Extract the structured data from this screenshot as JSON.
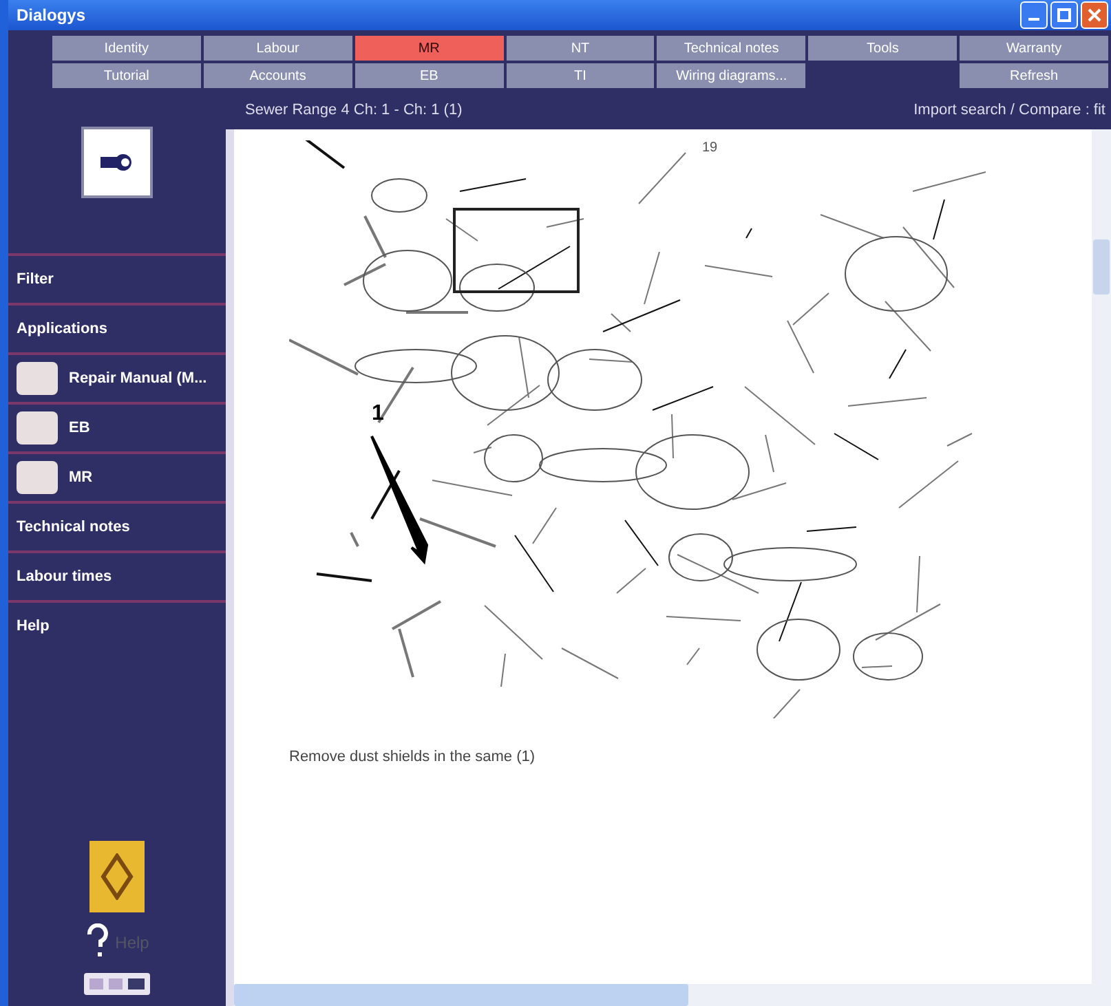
{
  "window": {
    "title": "Dialogys"
  },
  "tabs_row_1": [
    {
      "label": "Identity",
      "selected": false
    },
    {
      "label": "Labour",
      "selected": false
    },
    {
      "label": "MR",
      "selected": true
    },
    {
      "label": "NT",
      "selected": false
    },
    {
      "label": "Technical notes",
      "selected": false
    },
    {
      "label": "Tools",
      "selected": false
    },
    {
      "label": "Warranty",
      "selected": false
    }
  ],
  "tabs_row_2": [
    {
      "label": "Tutorial",
      "selected": false
    },
    {
      "label": "Accounts",
      "selected": false
    },
    {
      "label": "EB",
      "selected": false
    },
    {
      "label": "TI",
      "selected": false
    },
    {
      "label": "Wiring diagrams...",
      "selected": false
    },
    {
      "label": "Refresh",
      "selected": false
    }
  ],
  "document": {
    "header": "Sewer Range 4 Ch: 1 - Ch: 1 (1)",
    "header_link": "Import search / Compare : fit",
    "figure_label": "1",
    "figure_mark": "19",
    "caption": "Remove dust shields in the same (1)"
  },
  "sidebar": {
    "items": [
      {
        "kind": "heading",
        "label": "Filter"
      },
      {
        "kind": "heading",
        "label": "Applications"
      },
      {
        "kind": "icon-item",
        "label": "Repair Manual (M..."
      },
      {
        "kind": "icon-item",
        "label": "EB"
      },
      {
        "kind": "icon-item",
        "label": "MR"
      },
      {
        "kind": "heading",
        "label": "Technical notes"
      },
      {
        "kind": "heading",
        "label": "Labour times"
      },
      {
        "kind": "heading",
        "label": "Help"
      }
    ],
    "help_label": "Help"
  }
}
